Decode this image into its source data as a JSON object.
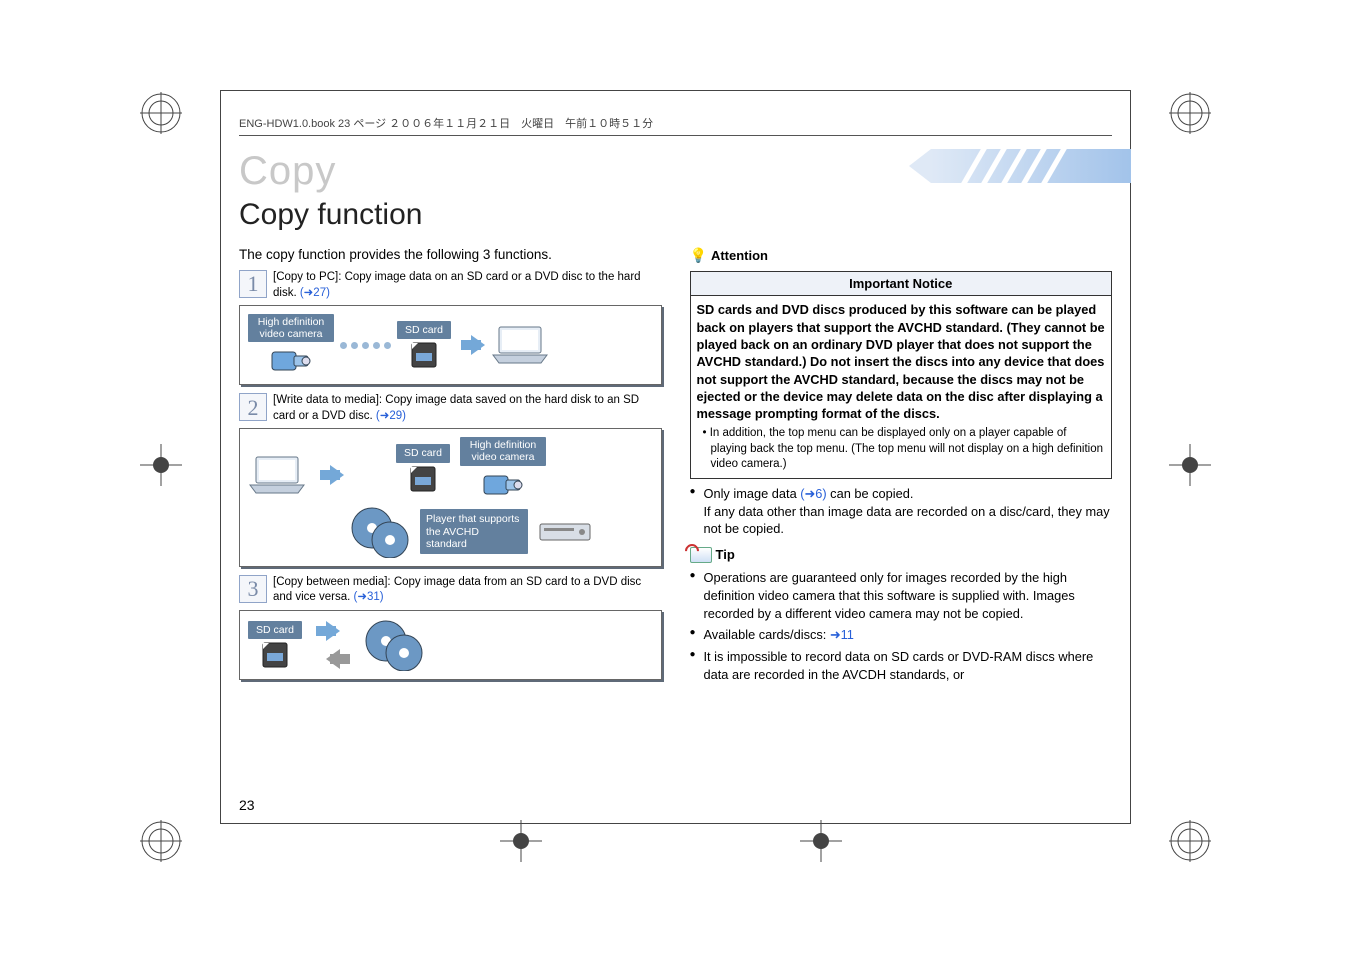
{
  "header_line": "ENG-HDW1.0.book  23 ページ  ２００６年１１月２１日　火曜日　午前１０時５１分",
  "chapter": "Copy",
  "title": "Copy function",
  "page_number": "23",
  "intro": "The copy function provides the following 3 functions.",
  "steps": [
    {
      "num": "1",
      "text_a": "[Copy to PC]: Copy image data on an SD card or a DVD disc to the hard disk. ",
      "link": "(➜27)"
    },
    {
      "num": "2",
      "text_a": "[Write data to media]: Copy image data saved on the hard disk to an SD card or a DVD disc. ",
      "link": "(➜29)"
    },
    {
      "num": "3",
      "text_a": "[Copy between media]: Copy image data from an SD card to a DVD disc and vice versa. ",
      "link": "(➜31)"
    }
  ],
  "labels": {
    "hd_camera": "High definition video camera",
    "sd_card": "SD card",
    "player_avchd": "Player that supports the AVCHD standard"
  },
  "attention": {
    "heading": "Attention",
    "notice_title": "Important Notice",
    "notice_body": "SD cards and DVD discs produced by this software can be played back on players that support the AVCHD standard. (They cannot be played back on an ordinary DVD player that does not support the AVCHD standard.) Do not insert the discs into any device that does not support the AVCHD standard, because the discs may not be ejected or the device may delete data on the disc after displaying a message prompting format of the discs.",
    "notice_sub": "In addition, the top menu can be displayed only on a player capable of playing back the top menu. (The top menu will not display on a high definition video camera.)",
    "bullets": [
      {
        "pre": "Only image data ",
        "link": "(➜6)",
        "post": " can be copied.",
        "cont": "If any data other than image data are recorded on a disc/card, they may not be copied."
      }
    ]
  },
  "tip": {
    "heading": "Tip",
    "items": [
      "Operations are guaranteed only for images recorded by the high definition video camera that this software is supplied with. Images recorded by a different video camera may not be copied.",
      {
        "pre": "Available cards/discs: ",
        "link": "➜11"
      },
      "It is impossible to record data on SD cards or DVD-RAM discs where data are recorded in the AVCDH standards, or"
    ]
  }
}
